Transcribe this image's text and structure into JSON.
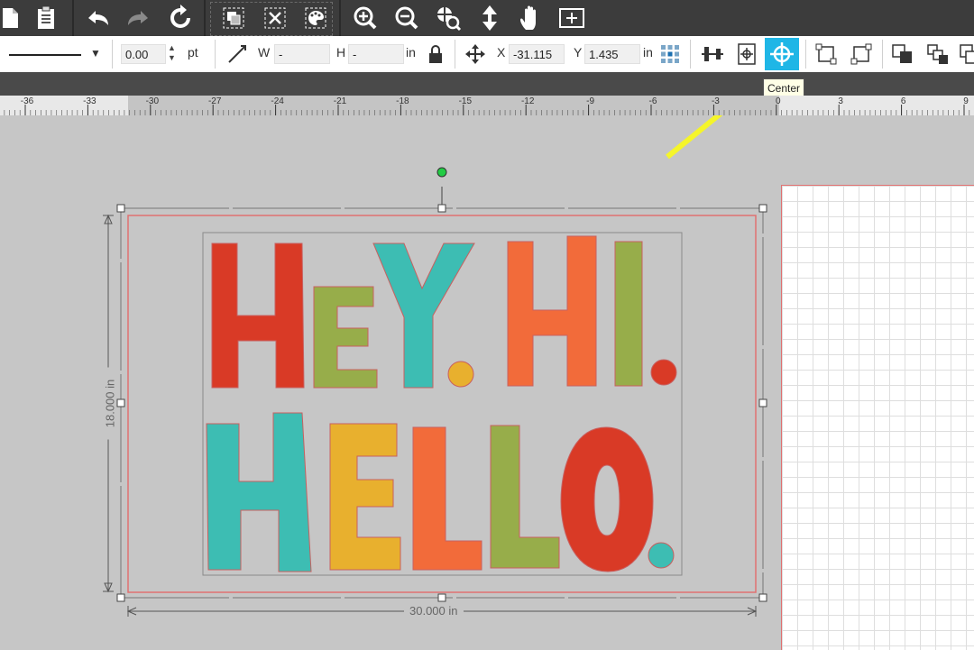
{
  "toolbar_top": {
    "icons": [
      "document-icon",
      "clipboard-icon",
      "undo-icon",
      "redo-icon",
      "refresh-icon",
      "group-icon",
      "ungroup-icon",
      "color-palette-icon",
      "zoom-in-icon",
      "zoom-out-icon",
      "zoom-select-icon",
      "move-icon",
      "pan-hand-icon",
      "fit-to-page-icon"
    ]
  },
  "toolbar_props": {
    "line_width_value": "0.00",
    "line_width_unit": "pt",
    "width_label": "W",
    "width_value": "-",
    "height_label": "H",
    "height_value": "-",
    "size_unit": "in",
    "x_label": "X",
    "x_value": "-31.115",
    "y_label": "Y",
    "y_value": "1.435",
    "position_unit": "in",
    "tooltip": "Center"
  },
  "ruler": {
    "ticks": [
      "-36",
      "-33",
      "-30",
      "-27",
      "-24",
      "-21",
      "-18",
      "-15",
      "-12",
      "-9",
      "-6",
      "-3",
      "0",
      "3",
      "6",
      "9"
    ]
  },
  "canvas": {
    "width_dimension": "30.000 in",
    "height_dimension": "18.000 in",
    "design_text_line1": [
      "H",
      "E",
      "Y",
      ".",
      "H",
      "I",
      "."
    ],
    "design_text_line2": [
      "H",
      "E",
      "L",
      "L",
      "O",
      "."
    ]
  },
  "colors": {
    "accent_active": "#1fb6e6",
    "arrow": "#f5f52a",
    "red": "#d93a26",
    "green": "#97ad4a",
    "teal": "#3dbdb3",
    "orange": "#f26b3a",
    "yellow": "#e8b02e"
  }
}
